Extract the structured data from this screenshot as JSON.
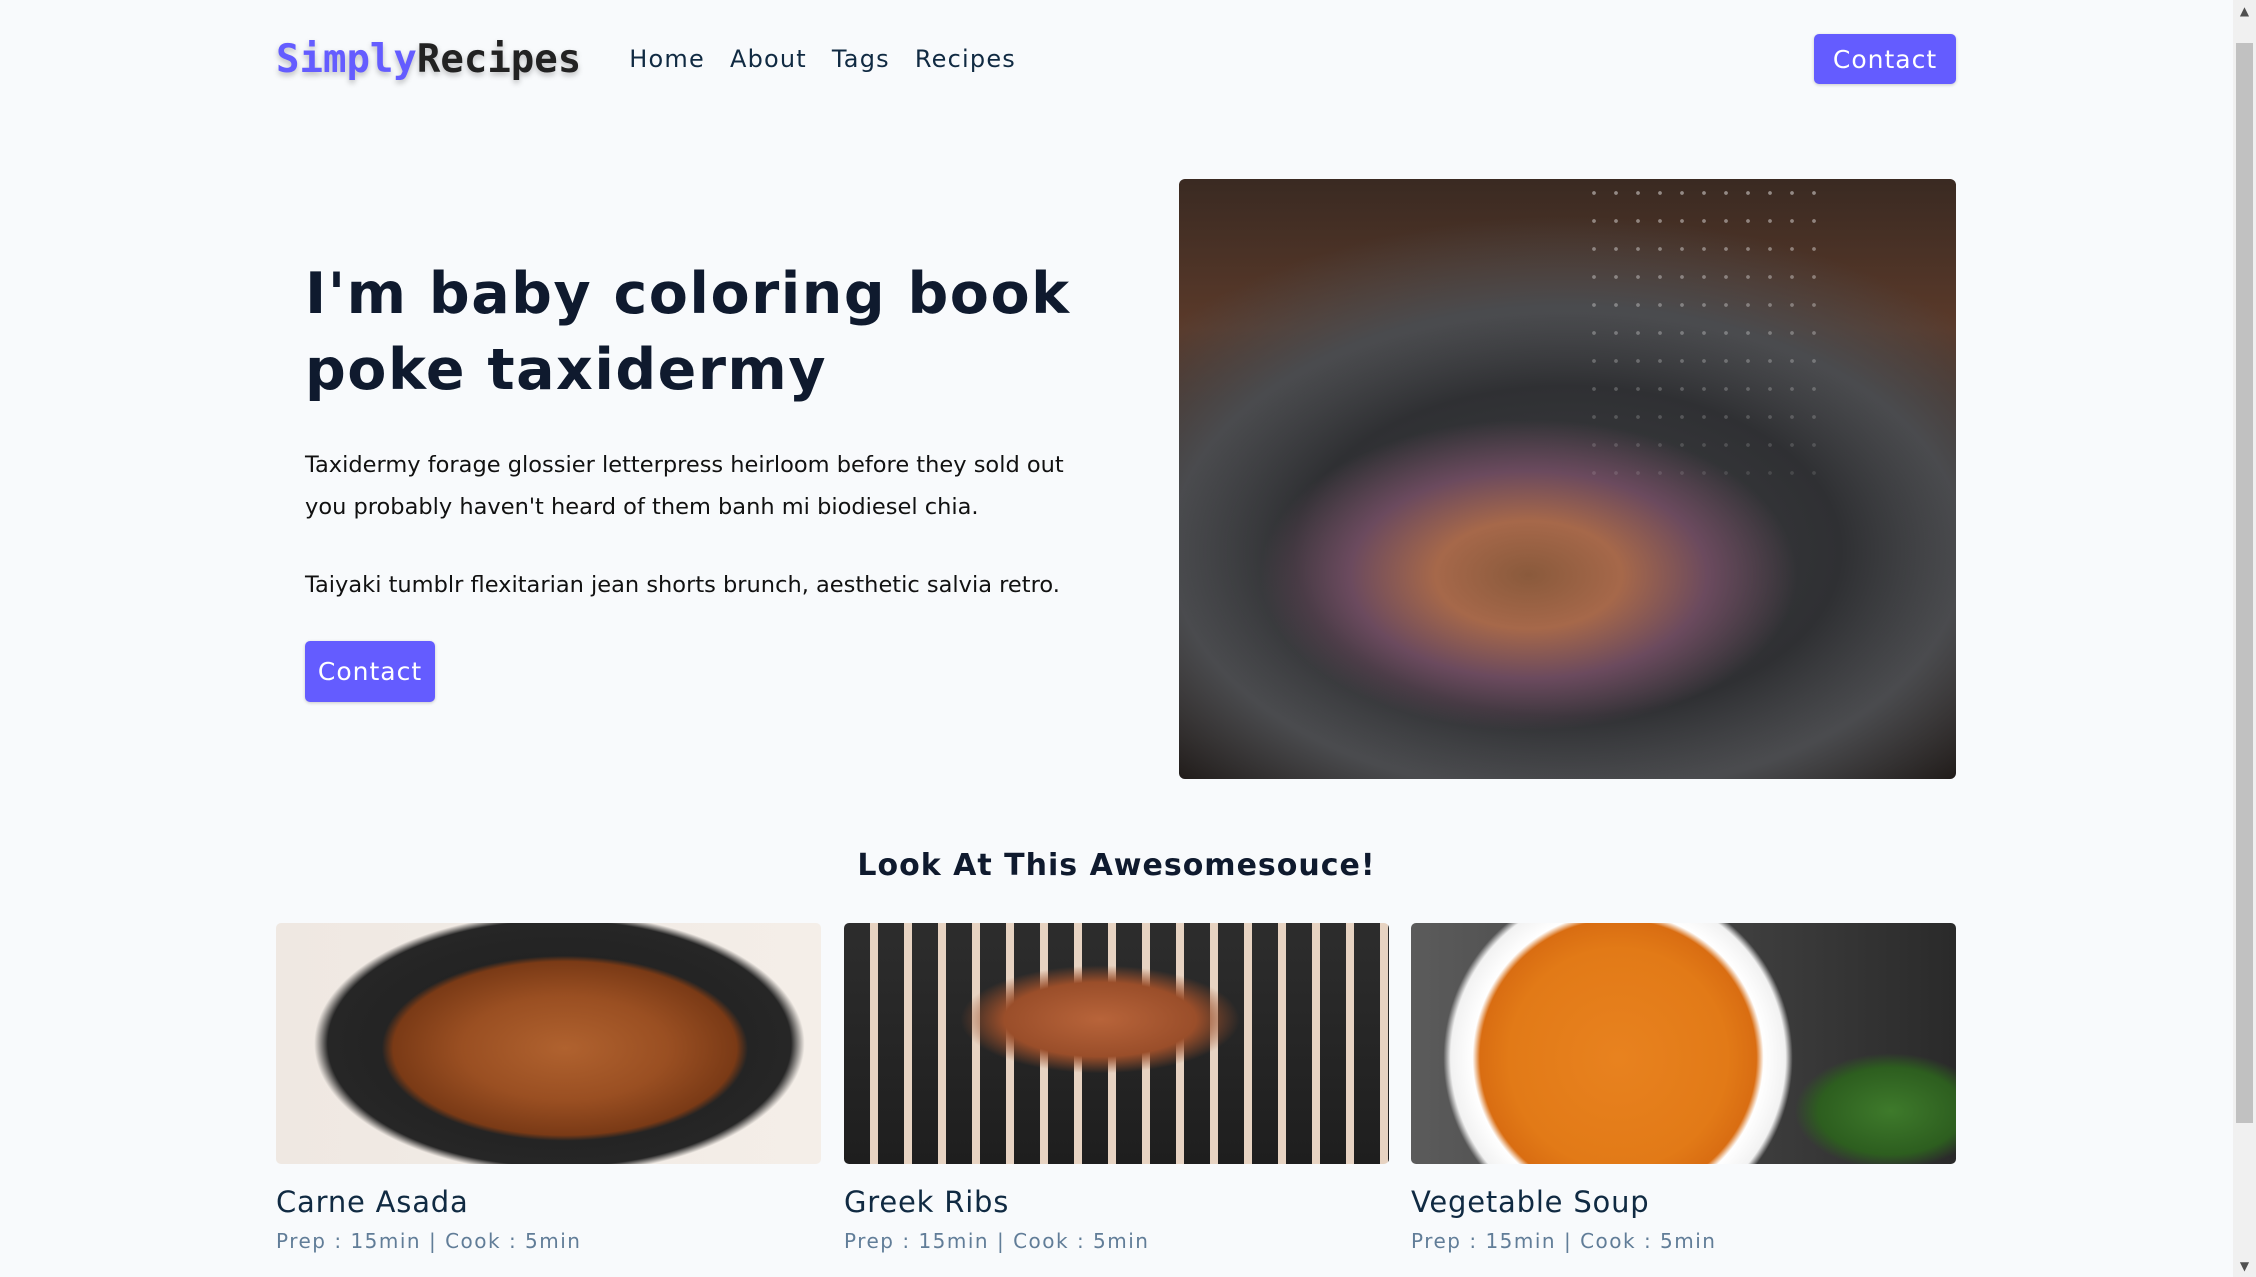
{
  "nav": {
    "logo_part1": "Simply",
    "logo_part2": "Recipes",
    "links": [
      "Home",
      "About",
      "Tags",
      "Recipes"
    ],
    "contact_label": "Contact"
  },
  "hero": {
    "title": "I'm baby coloring book poke taxidermy",
    "paragraph1": "Taxidermy forage glossier letterpress heirloom before they sold out you probably haven't heard of them banh mi biodiesel chia.",
    "paragraph2": "Taiyaki tumblr flexitarian jean shorts brunch, aesthetic salvia retro.",
    "contact_label": "Contact"
  },
  "featured": {
    "title": "Look At This Awesomesouce!",
    "recipes": [
      {
        "name": "Carne Asada",
        "meta": "Prep : 15min | Cook : 5min"
      },
      {
        "name": "Greek Ribs",
        "meta": "Prep : 15min | Cook : 5min"
      },
      {
        "name": "Vegetable Soup",
        "meta": "Prep : 15min | Cook : 5min"
      }
    ]
  },
  "colors": {
    "primary": "#645cff",
    "background": "#f8fafc",
    "heading": "#102a42",
    "meta": "#617d98"
  },
  "icons": {
    "scroll_up": "▲",
    "scroll_down": "▼"
  }
}
